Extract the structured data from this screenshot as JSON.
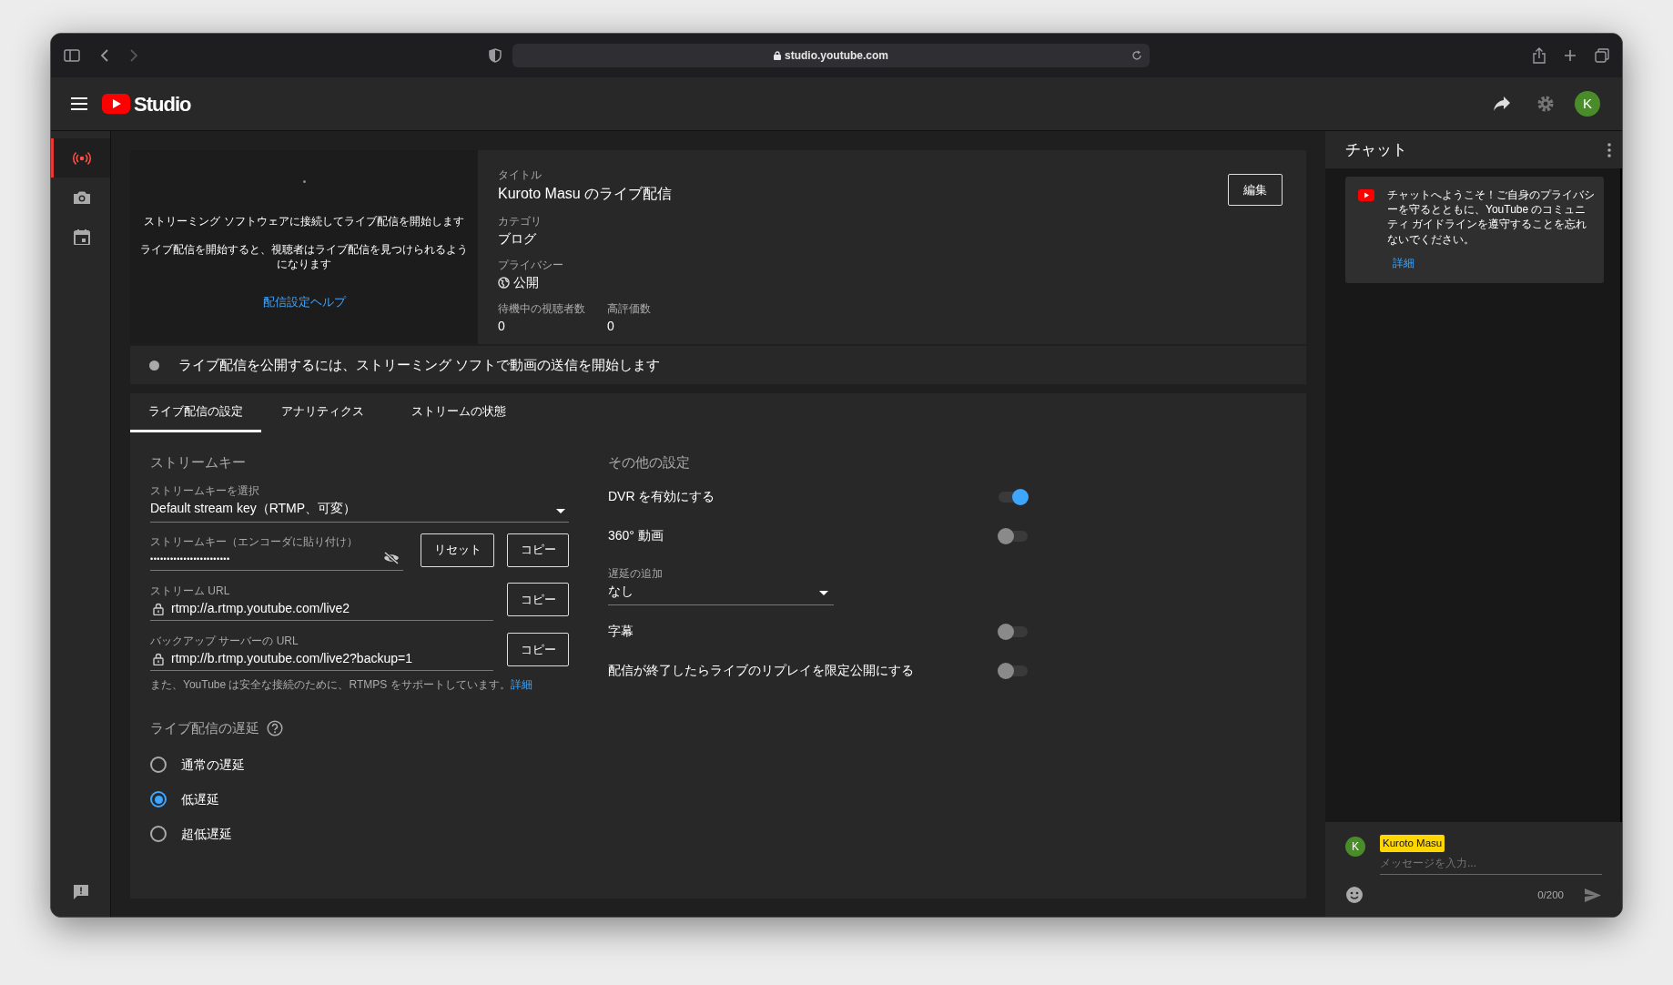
{
  "browser": {
    "url": "studio.youtube.com"
  },
  "header": {
    "logo_text": "Studio",
    "avatar_letter": "K"
  },
  "sidebar": {
    "items": [
      {
        "kind": "live",
        "selected": true
      },
      {
        "kind": "camera",
        "selected": false
      },
      {
        "kind": "calendar",
        "selected": false
      }
    ]
  },
  "preview": {
    "lines": [
      "ストリーミング ソフトウェアに接続してライブ配信を開始します",
      "ライブ配信を開始すると、視聴者はライブ配信を見つけられるようになります"
    ],
    "help_link": "配信設定ヘルプ"
  },
  "details": {
    "fields": [
      {
        "label": "タイトル",
        "value": "Kuroto Masu のライブ配信",
        "kind": "title"
      },
      {
        "label": "カテゴリ",
        "value": "ブログ",
        "kind": "text"
      },
      {
        "label": "プライバシー",
        "value": "公開",
        "kind": "privacy"
      }
    ],
    "stats": [
      {
        "label": "待機中の視聴者数",
        "value": "0"
      },
      {
        "label": "高評価数",
        "value": "0"
      }
    ],
    "edit_button": "編集"
  },
  "status": {
    "text": "ライブ配信を公開するには、ストリーミング ソフトで動画の送信を開始します"
  },
  "tabs": [
    {
      "label": "ライブ配信の設定",
      "selected": true
    },
    {
      "label": "アナリティクス",
      "selected": false
    },
    {
      "label": "ストリームの状態",
      "selected": false
    }
  ],
  "stream_key": {
    "heading": "ストリームキー",
    "select": {
      "label": "ストリームキーを選択",
      "value": "Default stream key（RTMP、可変）"
    },
    "key_field": {
      "label": "ストリームキー（エンコーダに貼り付け）",
      "value": "••••••••••••••••••••••••"
    },
    "reset_button": "リセット",
    "url_fields": [
      {
        "label": "ストリーム URL",
        "value": "rtmp://a.rtmp.youtube.com/live2"
      },
      {
        "label": "バックアップ サーバーの URL",
        "value": "rtmp://b.rtmp.youtube.com/live2?backup=1"
      }
    ],
    "copy_buttons": [
      "コピー",
      "コピー",
      "コピー"
    ],
    "note": "また、YouTube は安全な接続のために、RTMPS をサポートしています。",
    "note_link": "詳細"
  },
  "latency": {
    "heading": "ライブ配信の遅延",
    "options": [
      {
        "label": "通常の遅延",
        "selected": false
      },
      {
        "label": "低遅延",
        "selected": true
      },
      {
        "label": "超低遅延",
        "selected": false
      }
    ]
  },
  "other_settings": {
    "heading": "その他の設定",
    "items": [
      {
        "kind": "toggle",
        "label": "DVR を有効にする",
        "on": true
      },
      {
        "kind": "toggle",
        "label": "360° 動画",
        "on": false
      },
      {
        "kind": "select",
        "label": "遅延の追加",
        "value": "なし"
      },
      {
        "kind": "toggle",
        "label": "字幕",
        "on": false
      },
      {
        "kind": "toggle",
        "label": "配信が終了したらライブのリプレイを限定公開にする",
        "on": false
      }
    ]
  },
  "chat": {
    "title": "チャット",
    "welcome": {
      "text": "チャットへようこそ！ご自身のプライバシーを守るとともに、YouTube のコミュニティ ガイドラインを遵守することを忘れないでください。",
      "link": "詳細"
    },
    "author": "Kuroto Masu",
    "avatar_letter": "K",
    "placeholder": "メッセージを入力...",
    "counter": "0/200"
  }
}
